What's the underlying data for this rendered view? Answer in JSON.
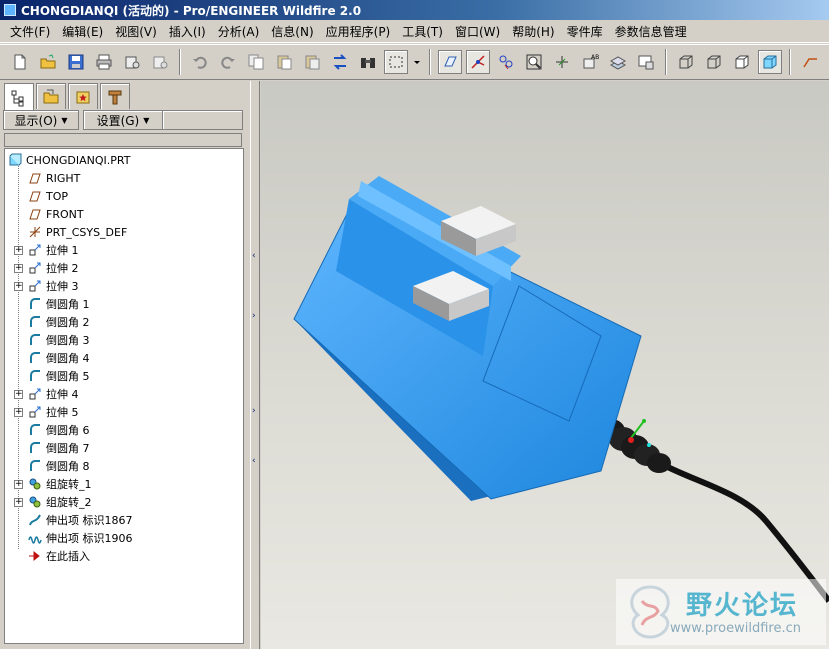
{
  "window": {
    "title": "CHONGDIANQI (活动的) - Pro/ENGINEER Wildfire 2.0"
  },
  "menu": [
    "文件(F)",
    "编辑(E)",
    "视图(V)",
    "插入(I)",
    "分析(A)",
    "信息(N)",
    "应用程序(P)",
    "工具(T)",
    "窗口(W)",
    "帮助(H)",
    "零件库",
    "参数信息管理"
  ],
  "panel": {
    "show_label": "显示(O)",
    "settings_label": "设置(G)"
  },
  "tree": {
    "root": "CHONGDIANQI.PRT",
    "items": [
      "RIGHT",
      "TOP",
      "FRONT",
      "PRT_CSYS_DEF",
      "拉伸 1",
      "拉伸 2",
      "拉伸 3",
      "倒圆角 1",
      "倒圆角 2",
      "倒圆角 3",
      "倒圆角 4",
      "倒圆角 5",
      "拉伸 4",
      "拉伸 5",
      "倒圆角 6",
      "倒圆角 7",
      "倒圆角 8",
      "组旋转_1",
      "组旋转_2",
      "伸出项 标识1867",
      "伸出项 标识1906",
      "在此插入"
    ]
  },
  "watermark": {
    "title": "野火论坛",
    "url": "www.proewildfire.cn"
  },
  "colors": {
    "model_blue": "#2a8fdc",
    "title_bar": "#0a246a"
  }
}
